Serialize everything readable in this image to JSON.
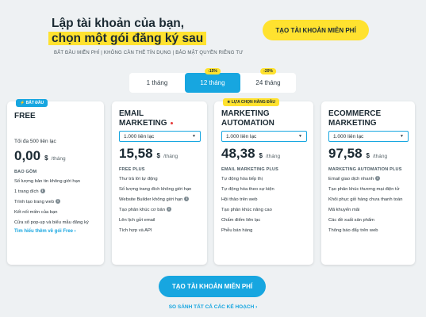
{
  "hero": {
    "title_line1": "Lập tài khoản của bạn,",
    "title_line2": "chọn một gói đăng ký sau",
    "subtitle": "BẮT ĐẦU MIỄN PHÍ | KHÔNG CẦN THẺ TÍN DỤNG | BẢO MẬT QUYỀN RIÊNG TƯ",
    "cta_label": "TẠO TÀI KHOẢN MIỄN PHÍ"
  },
  "period_tabs": [
    {
      "label": "1 tháng",
      "badge": "",
      "active": false
    },
    {
      "label": "12 tháng",
      "badge": "-15%",
      "active": true
    },
    {
      "label": "24 tháng",
      "badge": "-20%",
      "active": false
    }
  ],
  "plans": {
    "free": {
      "tag": "BẮT ĐẦU",
      "name": "FREE",
      "contacts": "Tối đa 500 liên lạc",
      "price": "0,00",
      "currency": "$",
      "period": "/tháng",
      "section": "BAO GỒM",
      "features": [
        "Số lượng bản tin không giới hạn",
        "1 trang đích",
        "Trình tạo trang web",
        "Kết nối miền của bạn",
        "Cửa sổ pop-up và biểu mẫu đăng ký"
      ],
      "learn_more": "Tìm hiểu thêm về gói Free ›"
    },
    "email": {
      "name_line1": "EMAIL",
      "name_line2": "MARKETING",
      "select": "1.000 liên lạc",
      "price": "15,58",
      "currency": "$",
      "period": "/tháng",
      "section": "FREE PLUS",
      "features": [
        "Thư trả lời tự động",
        "Số lượng trang đích không giới hạn",
        "Website Builder không giới hạn",
        "Tạo phân khúc cơ bản",
        "Lên lịch gửi email",
        "Tích hợp và API"
      ]
    },
    "ma": {
      "tag": "LỰA CHỌN HÀNG ĐẦU",
      "name_line1": "MARKETING",
      "name_line2": "AUTOMATION",
      "select": "1.000 liên lạc",
      "price": "48,38",
      "currency": "$",
      "period": "/tháng",
      "section": "EMAIL MARKETING PLUS",
      "features": [
        "Tự động hóa tiếp thị",
        "Tự động hóa theo sự kiện",
        "Hội thảo trên web",
        "Tạo phân khúc nâng cao",
        "Chấm điểm liên lạc",
        "Phễu bán hàng"
      ]
    },
    "ecom": {
      "name_line1": "ECOMMERCE",
      "name_line2": "MARKETING",
      "select": "1.000 liên lạc",
      "price": "97,58",
      "currency": "$",
      "period": "/tháng",
      "section": "MARKETING AUTOMATION PLUS",
      "features": [
        "Email giao dịch nhanh",
        "Tạo phân khúc thương mại điện tử",
        "Khôi phục giỏ hàng chưa thanh toán",
        "Mã khuyến mãi",
        "Các đề xuất sản phẩm",
        "Thông báo đẩy trên web"
      ]
    }
  },
  "bottom": {
    "cta_label": "TẠO TÀI KHOẢN MIỄN PHÍ",
    "compare_label": "SO SÁNH TẤT CẢ CÁC KẾ HOẠCH ›"
  },
  "icons": {
    "info": "info-icon",
    "star": "star-icon",
    "caret": "chevron-down-icon"
  },
  "colors": {
    "accent": "#17a6e0",
    "highlight": "#ffe22f",
    "background": "#eef1f3"
  }
}
